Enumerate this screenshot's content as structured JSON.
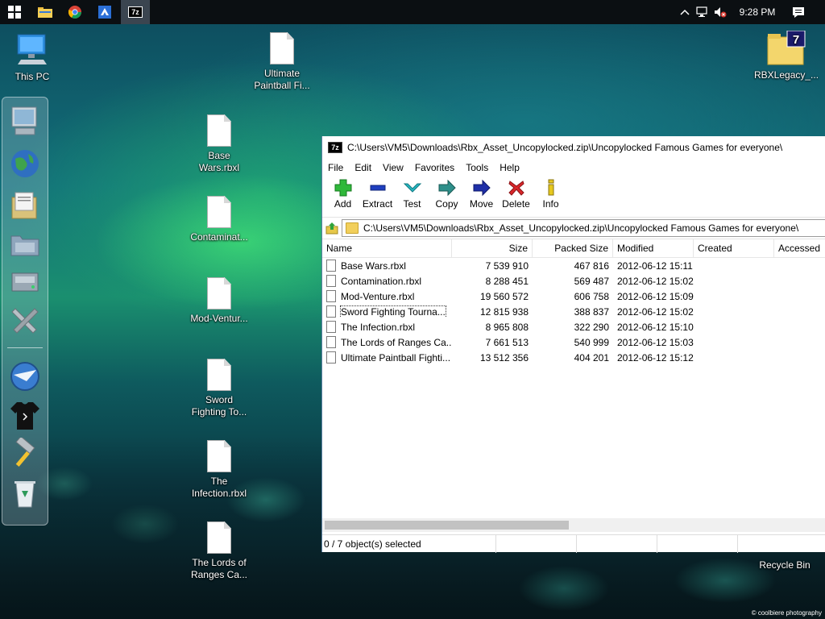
{
  "taskbar": {
    "clock": "9:28 PM",
    "apps": [
      {
        "name": "file-explorer"
      },
      {
        "name": "chrome"
      },
      {
        "name": "roblox-studio"
      },
      {
        "name": "7zip",
        "label": "7z"
      }
    ]
  },
  "desktop": {
    "icons": [
      {
        "label": "This PC"
      },
      {
        "label": "Ultimate Paintball Fi..."
      },
      {
        "label": "Base Wars.rbxl"
      },
      {
        "label": "Contaminat..."
      },
      {
        "label": "Mod-Ventur..."
      },
      {
        "label": "Sword Fighting To..."
      },
      {
        "label": "The Infection.rbxl"
      },
      {
        "label": "The Lords of Ranges Ca..."
      },
      {
        "label": "RBXLegacy_..."
      },
      {
        "label": "Recycle Bin"
      }
    ],
    "photo_credit": "© coolbiere photography"
  },
  "window": {
    "title": "C:\\Users\\VM5\\Downloads\\Rbx_Asset_Uncopylocked.zip\\Uncopylocked Famous Games for everyone\\",
    "menu": [
      "File",
      "Edit",
      "View",
      "Favorites",
      "Tools",
      "Help"
    ],
    "toolbar": [
      "Add",
      "Extract",
      "Test",
      "Copy",
      "Move",
      "Delete",
      "Info"
    ],
    "address": "C:\\Users\\VM5\\Downloads\\Rbx_Asset_Uncopylocked.zip\\Uncopylocked Famous Games for everyone\\",
    "columns": [
      "Name",
      "Size",
      "Packed Size",
      "Modified",
      "Created",
      "Accessed"
    ],
    "rows": [
      {
        "name": "Base Wars.rbxl",
        "size": "7 539 910",
        "packed": "467 816",
        "modified": "2012-06-12 15:11"
      },
      {
        "name": "Contamination.rbxl",
        "size": "8 288 451",
        "packed": "569 487",
        "modified": "2012-06-12 15:02"
      },
      {
        "name": "Mod-Venture.rbxl",
        "size": "19 560 572",
        "packed": "606 758",
        "modified": "2012-06-12 15:09"
      },
      {
        "name": "Sword Fighting Tourna...",
        "size": "12 815 938",
        "packed": "388 837",
        "modified": "2012-06-12 15:02"
      },
      {
        "name": "The Infection.rbxl",
        "size": "8 965 808",
        "packed": "322 290",
        "modified": "2012-06-12 15:10"
      },
      {
        "name": "The Lords of Ranges Ca...",
        "size": "7 661 513",
        "packed": "540 999",
        "modified": "2012-06-12 15:03"
      },
      {
        "name": "Ultimate Paintball Fighti...",
        "size": "13 512 356",
        "packed": "404 201",
        "modified": "2012-06-12 15:12"
      }
    ],
    "status": "0 / 7 object(s) selected"
  }
}
